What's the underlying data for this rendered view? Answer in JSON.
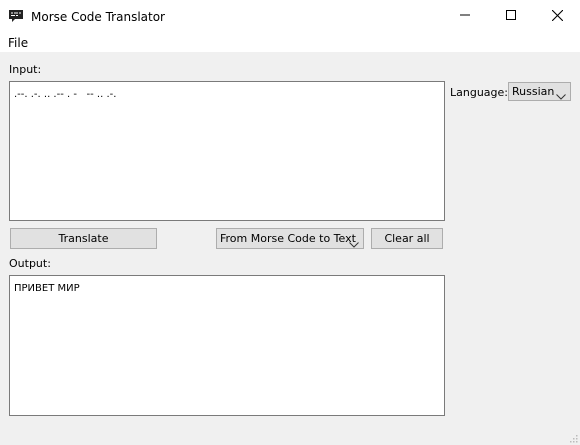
{
  "window": {
    "title": "Morse Code Translator",
    "icons": {
      "app": "chat-bubble-icon",
      "minimize": "minimize-icon",
      "maximize": "maximize-icon",
      "close": "close-icon"
    }
  },
  "menu": {
    "file_label": "File"
  },
  "input": {
    "label": "Input:",
    "value": ".--. .-. .. .-- . -   -- .. .-."
  },
  "language": {
    "label": "Language:",
    "selected": "Russian"
  },
  "actions": {
    "translate_label": "Translate",
    "direction_selected": "From Morse Code to Text",
    "clear_label": "Clear all"
  },
  "output": {
    "label": "Output:",
    "value": "ПРИВЕТ МИР"
  },
  "colors": {
    "window_bg": "#f0f0f0",
    "titlebar_bg": "#ffffff",
    "button_bg": "#e1e1e1",
    "border": "#adadad"
  }
}
